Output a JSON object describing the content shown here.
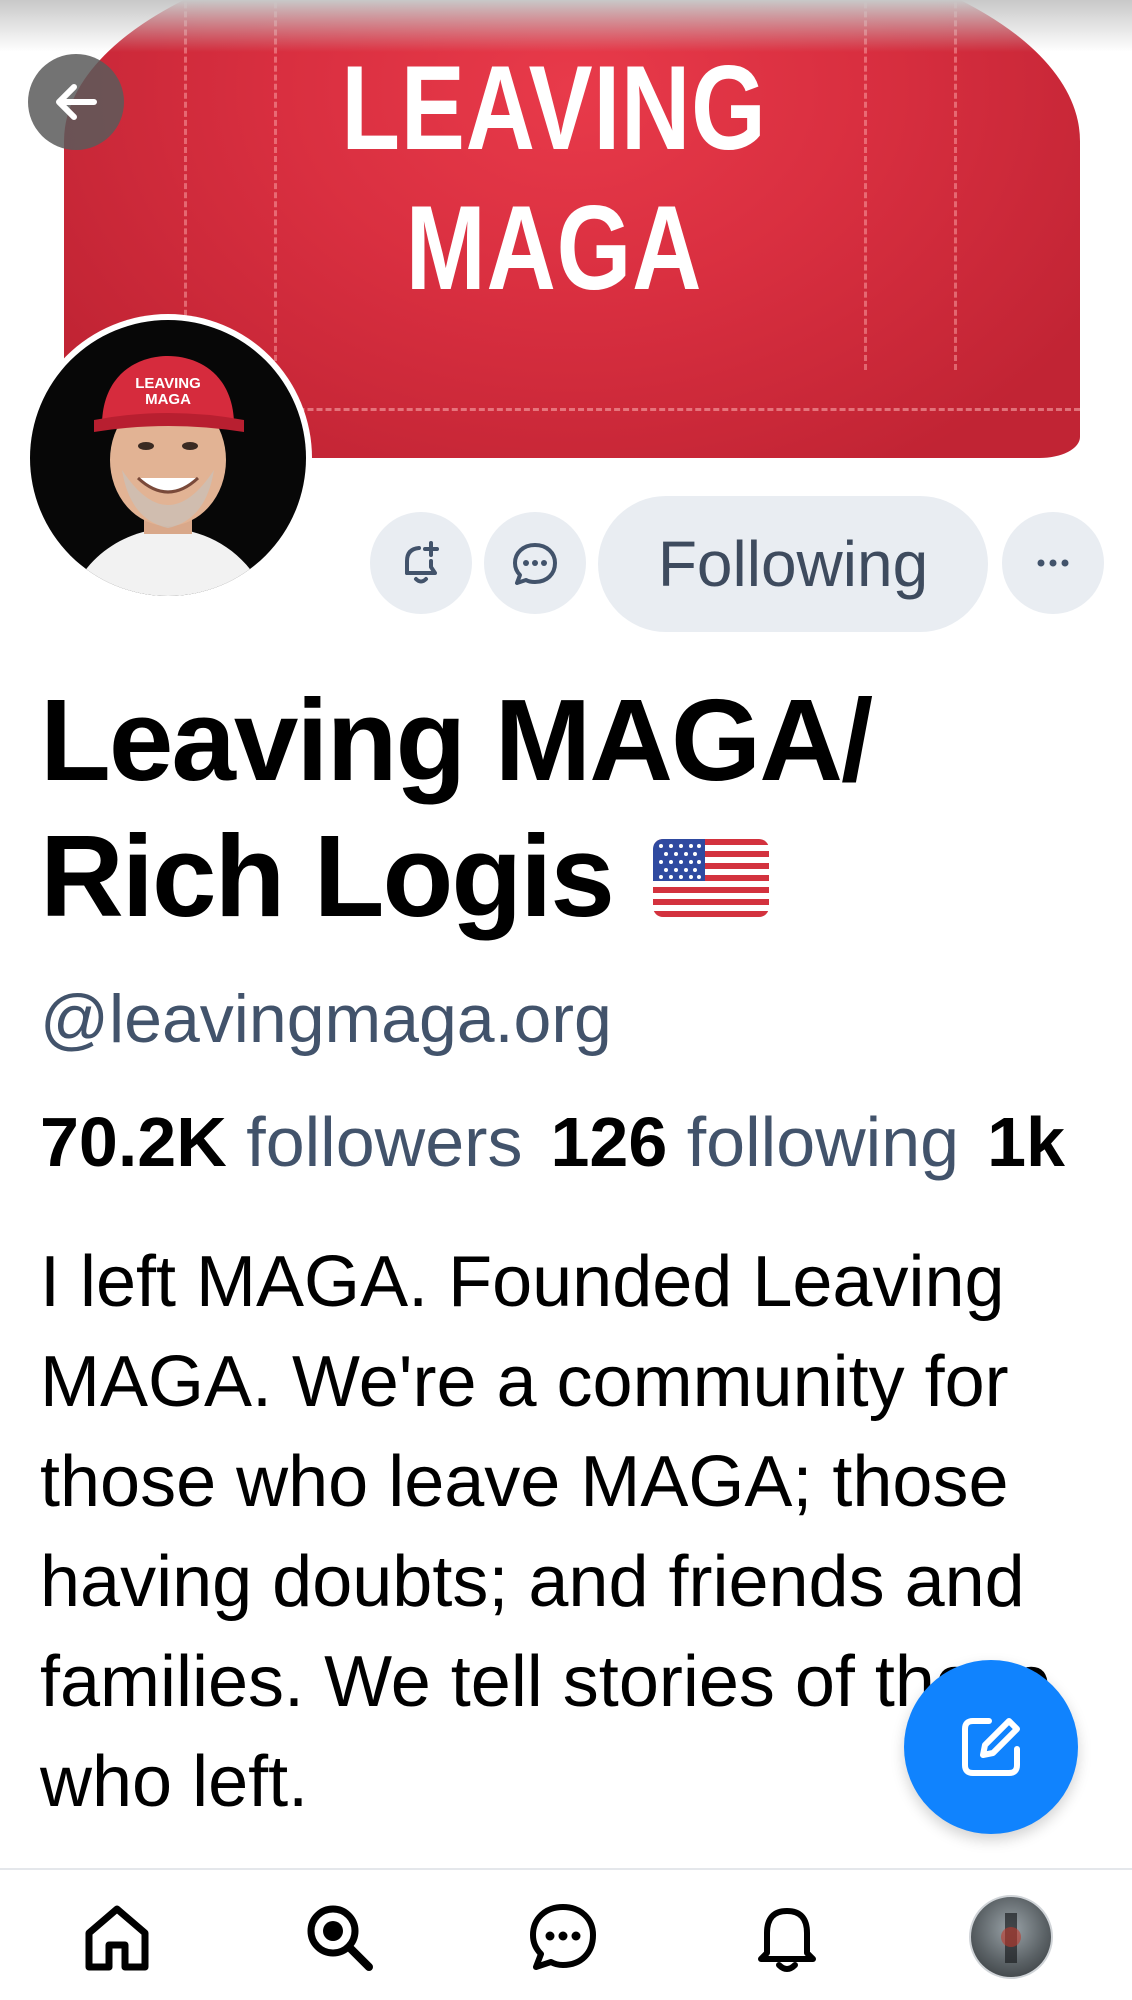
{
  "banner": {
    "hat_text_line1": "LEAVING",
    "hat_text_line2": "MAGA",
    "hat_color": "#d92f40"
  },
  "avatar": {
    "hat_text_line1": "LEAVING",
    "hat_text_line2": "MAGA"
  },
  "toolbar": {
    "back_icon": "arrow-left-icon",
    "notify_icon": "bell-plus-icon",
    "message_icon": "chat-bubble-icon",
    "following_label": "Following",
    "more_icon": "ellipsis-icon"
  },
  "profile": {
    "display_name_line1": "Leaving MAGA/",
    "display_name_line2": "Rich Logis",
    "flag_icon": "us-flag-icon",
    "handle": "@leavingmaga.org",
    "stats": {
      "followers_count": "70.2K",
      "followers_label": "followers",
      "following_count": "126",
      "following_label": "following",
      "posts_count": "1k"
    },
    "bio": "I left MAGA. Founded Leaving MAGA. We're a community for those who leave MAGA; those having doubts; and friends and families. We tell stories of those who left."
  },
  "compose": {
    "icon": "compose-icon",
    "color": "#1083fe"
  },
  "bottom_nav": {
    "items": [
      "home-icon",
      "search-icon",
      "chat-icon",
      "notifications-icon",
      "profile-avatar"
    ]
  },
  "colors": {
    "muted_text": "#42536b",
    "button_bg": "#e9edf2",
    "accent": "#1083fe"
  }
}
